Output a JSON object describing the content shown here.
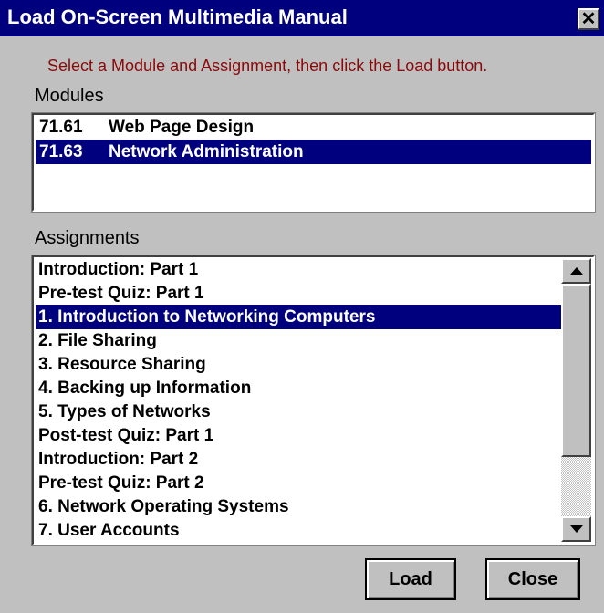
{
  "window": {
    "title": "Load On-Screen Multimedia Manual",
    "close_glyph": "✕"
  },
  "instruction": "Select a Module and Assignment, then click the Load button.",
  "modules": {
    "label": "Modules",
    "items": [
      {
        "code": "71.61",
        "name": "Web Page Design",
        "selected": false
      },
      {
        "code": "71.63",
        "name": "Network Administration",
        "selected": true
      }
    ]
  },
  "assignments": {
    "label": "Assignments",
    "items": [
      {
        "text": "Introduction: Part 1",
        "selected": false
      },
      {
        "text": "Pre-test Quiz: Part 1",
        "selected": false
      },
      {
        "text": "1. Introduction to Networking Computers",
        "selected": true
      },
      {
        "text": "2. File Sharing",
        "selected": false
      },
      {
        "text": "3. Resource Sharing",
        "selected": false
      },
      {
        "text": "4. Backing up Information",
        "selected": false
      },
      {
        "text": "5. Types of Networks",
        "selected": false
      },
      {
        "text": "Post-test Quiz: Part 1",
        "selected": false
      },
      {
        "text": "Introduction: Part 2",
        "selected": false
      },
      {
        "text": "Pre-test Quiz: Part 2",
        "selected": false
      },
      {
        "text": "6. Network Operating Systems",
        "selected": false
      },
      {
        "text": "7. User Accounts",
        "selected": false
      }
    ]
  },
  "scrollbar": {
    "up_icon": "arrow-up-icon",
    "down_icon": "arrow-down-icon"
  },
  "buttons": {
    "load": "Load",
    "close": "Close"
  },
  "colors": {
    "titlebar": "#00007e",
    "selection": "#00007e",
    "instruction": "#8a0a0a",
    "face": "#c0c0c0"
  }
}
